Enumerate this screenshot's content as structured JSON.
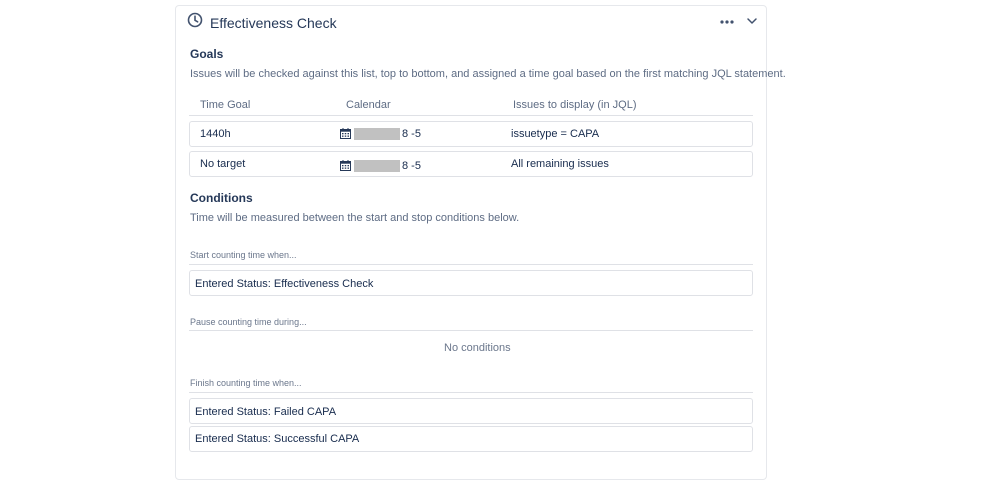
{
  "header": {
    "title": "Effectiveness Check",
    "clock_icon": "clock-icon",
    "more_icon": "more-horizontal-icon",
    "collapse_icon": "chevron-down-icon"
  },
  "goals": {
    "title": "Goals",
    "description": "Issues will be checked against this list, top to bottom, and assigned a time goal based on the first matching JQL statement.",
    "columns": [
      "Time Goal",
      "Calendar",
      "Issues to display (in JQL)"
    ],
    "rows": [
      {
        "time_goal": "1440h",
        "calendar_suffix": "8 -5",
        "jql": "issuetype = CAPA"
      },
      {
        "time_goal": "No target",
        "calendar_suffix": "8 -5",
        "jql": "All remaining issues"
      }
    ],
    "calendar_icon": "calendar-icon"
  },
  "conditions": {
    "title": "Conditions",
    "description": "Time will be measured between the start and stop conditions below.",
    "start": {
      "label": "Start counting time when...",
      "items": [
        "Entered Status: Effectiveness Check"
      ]
    },
    "pause": {
      "label": "Pause counting time during...",
      "empty_text": "No conditions"
    },
    "finish": {
      "label": "Finish counting time when...",
      "items": [
        "Entered Status: Failed CAPA",
        "Entered Status: Successful CAPA"
      ]
    }
  }
}
